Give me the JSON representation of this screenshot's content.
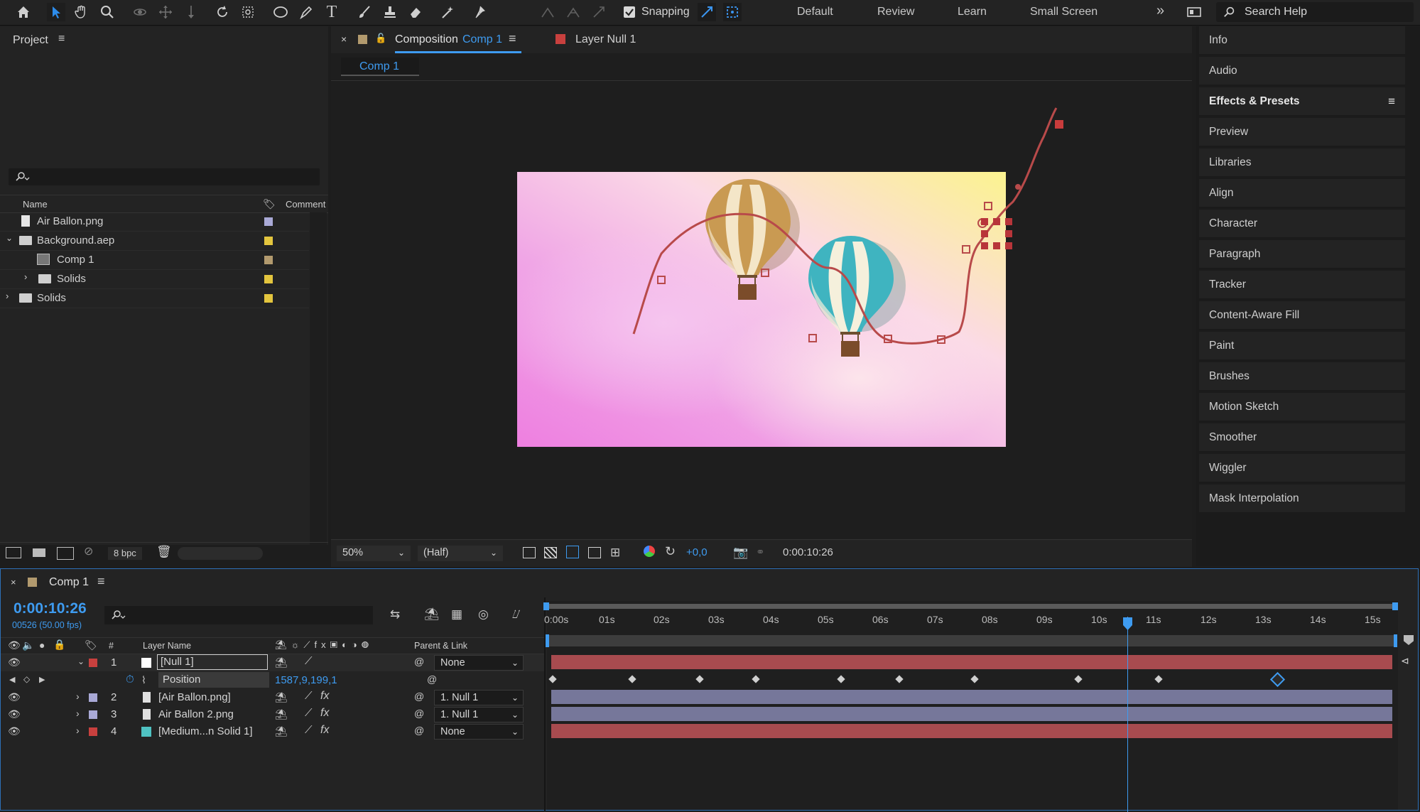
{
  "toolbar": {
    "snapping_label": "Snapping",
    "workspaces": [
      "Default",
      "Review",
      "Learn",
      "Small Screen"
    ],
    "search_placeholder": "Search Help"
  },
  "project": {
    "title": "Project",
    "columns": {
      "name": "Name",
      "comment": "Comment"
    },
    "items": [
      {
        "name": "Air Ballon.png",
        "icon": "file-icon",
        "color": "#a9a9d6"
      },
      {
        "name": "Background.aep",
        "icon": "folder-icon",
        "color": "#e3c53e"
      },
      {
        "name": "Comp 1",
        "icon": "composition-icon",
        "color": "#b29a6e"
      },
      {
        "name": "Solids",
        "icon": "folder-icon",
        "color": "#e3c53e"
      },
      {
        "name": "Solids",
        "icon": "folder-icon",
        "color": "#e3c53e"
      }
    ],
    "bpc": "8 bpc"
  },
  "viewer": {
    "tab_prefix": "Composition",
    "tab_comp": "Comp 1",
    "layer_tab": "Layer Null 1",
    "breadcrumb": "Comp 1",
    "zoom": "50%",
    "resolution": "(Half)",
    "exposure": "+0,0",
    "timecode": "0:00:10:26"
  },
  "right_panel": {
    "items": [
      "Info",
      "Audio",
      "Effects & Presets",
      "Preview",
      "Libraries",
      "Align",
      "Character",
      "Paragraph",
      "Tracker",
      "Content-Aware Fill",
      "Paint",
      "Brushes",
      "Motion Sketch",
      "Smoother",
      "Wiggler",
      "Mask Interpolation"
    ]
  },
  "timeline": {
    "tab": "Comp 1",
    "current_time": "0:00:10:26",
    "frame_info": "00526 (50.00 fps)",
    "col_layer_name": "Layer Name",
    "col_hash": "#",
    "col_parent": "Parent & Link",
    "ruler": [
      "0:00s",
      "01s",
      "02s",
      "03s",
      "04s",
      "05s",
      "06s",
      "07s",
      "08s",
      "09s",
      "10s",
      "11s",
      "12s",
      "13s",
      "14s",
      "15s"
    ],
    "layers": [
      {
        "num": "1",
        "name": "[Null 1]",
        "color": "#c8403e",
        "parent": "None"
      },
      {
        "num": "2",
        "name": "[Air Ballon.png]",
        "color": "#a9a9d6",
        "parent": "1. Null 1"
      },
      {
        "num": "3",
        "name": "Air Ballon 2.png",
        "color": "#a9a9d6",
        "parent": "1. Null 1"
      },
      {
        "num": "4",
        "name": "[Medium...n Solid 1]",
        "color": "#c8403e",
        "parent": "None"
      }
    ],
    "property": {
      "name": "Position",
      "value": "1587,9,199,1"
    }
  }
}
